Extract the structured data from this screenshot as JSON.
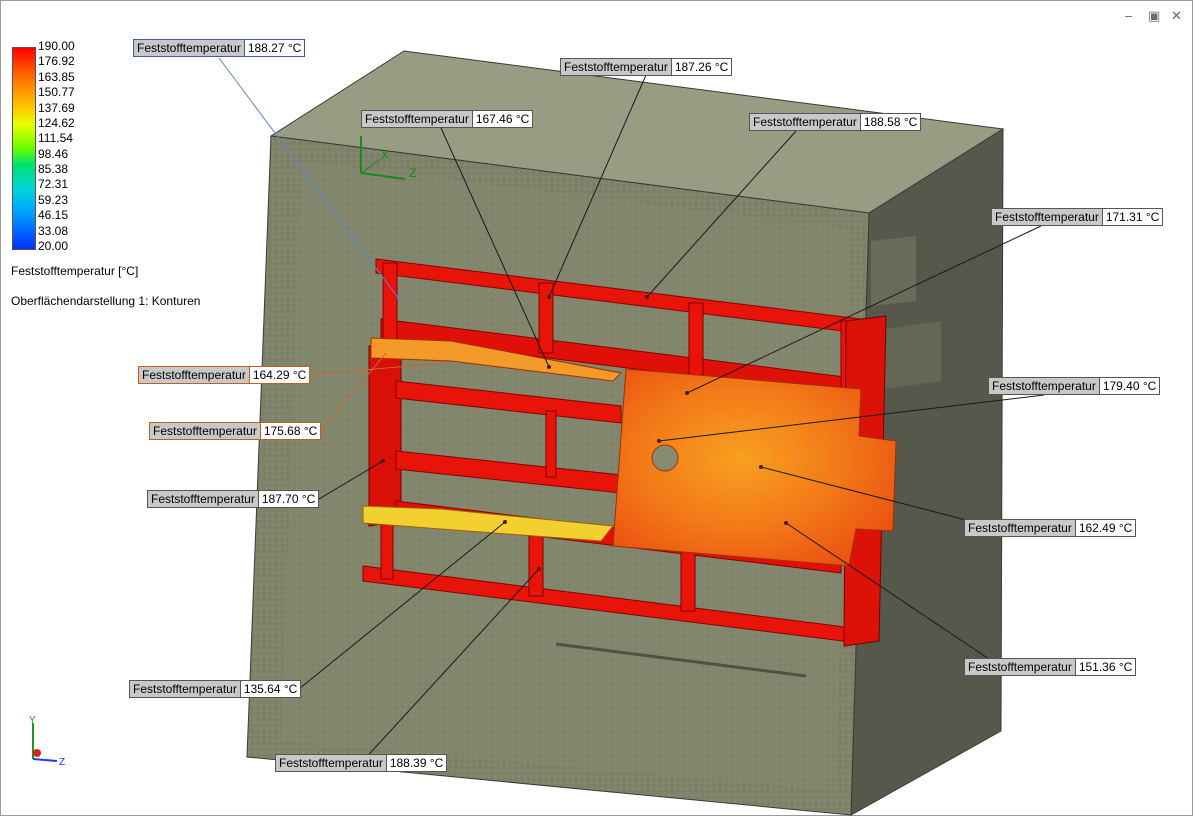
{
  "window_controls": {
    "minimize": "–",
    "restore": "▣",
    "close": "✕"
  },
  "legend": {
    "ticks": [
      "190.00",
      "176.92",
      "163.85",
      "150.77",
      "137.69",
      "124.62",
      "111.54",
      "98.46",
      "85.38",
      "72.31",
      "59.23",
      "46.15",
      "33.08",
      "20.00"
    ],
    "title": "Feststofftemperatur [°C]",
    "plot_name": "Oberflächendarstellung 1: Konturen"
  },
  "axes": {
    "x": "X",
    "y": "Y",
    "z": "Z"
  },
  "probes": [
    {
      "label": "Feststofftemperatur",
      "value": "188.27 °C"
    },
    {
      "label": "Feststofftemperatur",
      "value": "187.26 °C"
    },
    {
      "label": "Feststofftemperatur",
      "value": "167.46 °C"
    },
    {
      "label": "Feststofftemperatur",
      "value": "188.58 °C"
    },
    {
      "label": "Feststofftemperatur",
      "value": "171.31 °C"
    },
    {
      "label": "Feststofftemperatur",
      "value": "179.40 °C"
    },
    {
      "label": "Feststofftemperatur",
      "value": "164.29 °C"
    },
    {
      "label": "Feststofftemperatur",
      "value": "175.68 °C"
    },
    {
      "label": "Feststofftemperatur",
      "value": "187.70 °C"
    },
    {
      "label": "Feststofftemperatur",
      "value": "162.49 °C"
    },
    {
      "label": "Feststofftemperatur",
      "value": "151.36 °C"
    },
    {
      "label": "Feststofftemperatur",
      "value": "135.64 °C"
    },
    {
      "label": "Feststofftemperatur",
      "value": "188.39 °C"
    }
  ],
  "colors": {
    "hot": "#e8140a",
    "warm": "#ff7a10",
    "box": "#7d8268",
    "bar_top": "#ff0000",
    "bar_bottom": "#0030ff"
  }
}
